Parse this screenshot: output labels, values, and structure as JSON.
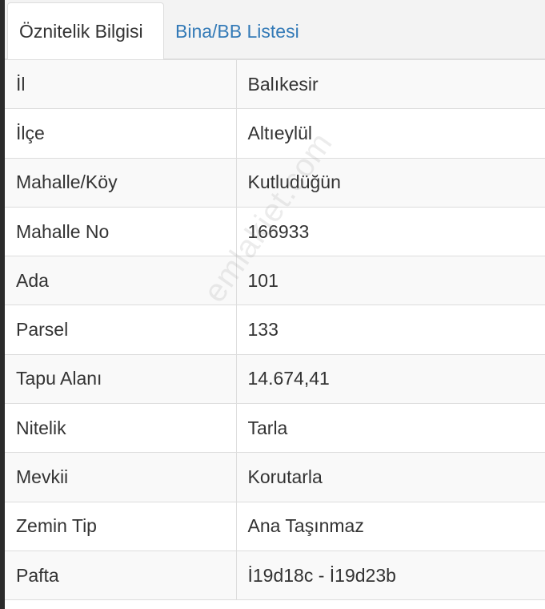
{
  "tabs": [
    {
      "label": "Öznitelik Bilgisi",
      "active": true
    },
    {
      "label": "Bina/BB Listesi",
      "active": false
    }
  ],
  "rows": [
    {
      "key": "İl",
      "value": "Balıkesir"
    },
    {
      "key": "İlçe",
      "value": "Altıeylül"
    },
    {
      "key": "Mahalle/Köy",
      "value": "Kutludüğün"
    },
    {
      "key": "Mahalle No",
      "value": "166933"
    },
    {
      "key": "Ada",
      "value": "101"
    },
    {
      "key": "Parsel",
      "value": "133"
    },
    {
      "key": "Tapu Alanı",
      "value": "14.674,41"
    },
    {
      "key": "Nitelik",
      "value": "Tarla"
    },
    {
      "key": "Mevkii",
      "value": "Korutarla"
    },
    {
      "key": "Zemin Tip",
      "value": "Ana Taşınmaz"
    },
    {
      "key": "Pafta",
      "value": "İ19d18c - İ19d23b"
    }
  ],
  "watermark": "emlakjet.com",
  "colors": {
    "link": "#337ab7",
    "text": "#333333",
    "border": "#dddddd"
  }
}
